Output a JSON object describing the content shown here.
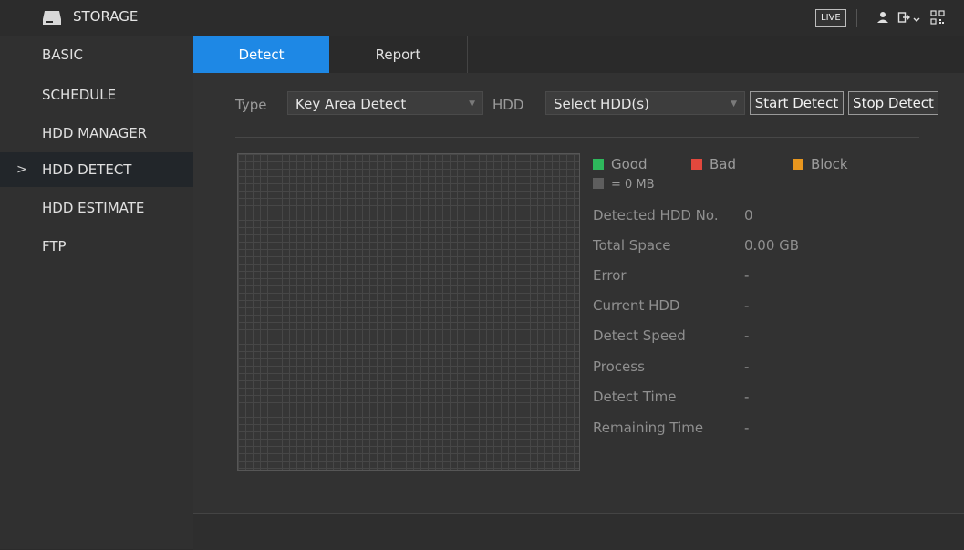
{
  "topbar": {
    "title": "STORAGE",
    "live_label": "LIVE",
    "icons": [
      "storage-icon",
      "user-icon",
      "logout-icon",
      "qr-icon"
    ]
  },
  "sidebar": {
    "items": [
      {
        "label": "BASIC"
      },
      {
        "label": "SCHEDULE"
      },
      {
        "label": "HDD MANAGER"
      },
      {
        "label": "HDD DETECT",
        "active": true
      },
      {
        "label": "HDD ESTIMATE"
      },
      {
        "label": "FTP"
      }
    ],
    "active_chevron": ">"
  },
  "tabs": [
    {
      "label": "Detect",
      "active": true
    },
    {
      "label": "Report"
    }
  ],
  "form": {
    "type_label": "Type",
    "type_value": "Key Area Detect",
    "hdd_label": "HDD",
    "hdd_value": "Select HDD(s)",
    "start_detect": "Start Detect",
    "stop_detect": "Stop Detect"
  },
  "legend": {
    "good": "Good",
    "bad": "Bad",
    "block": "Block",
    "unit": "= 0 MB",
    "colors": {
      "good": "#2eb85c",
      "bad": "#e2483d",
      "block": "#e8961e",
      "unit": "#5e5e5e"
    }
  },
  "info": [
    {
      "label": "Detected HDD No.",
      "value": "0"
    },
    {
      "label": "Total Space",
      "value": "0.00 GB"
    },
    {
      "label": "Error",
      "value": "-"
    },
    {
      "label": "Current HDD",
      "value": "-"
    },
    {
      "label": "Detect Speed",
      "value": "-"
    },
    {
      "label": "Process",
      "value": "-"
    },
    {
      "label": "Detect Time",
      "value": "-"
    },
    {
      "label": "Remaining Time",
      "value": "-"
    }
  ],
  "colors": {
    "accent": "#1e88e5"
  }
}
